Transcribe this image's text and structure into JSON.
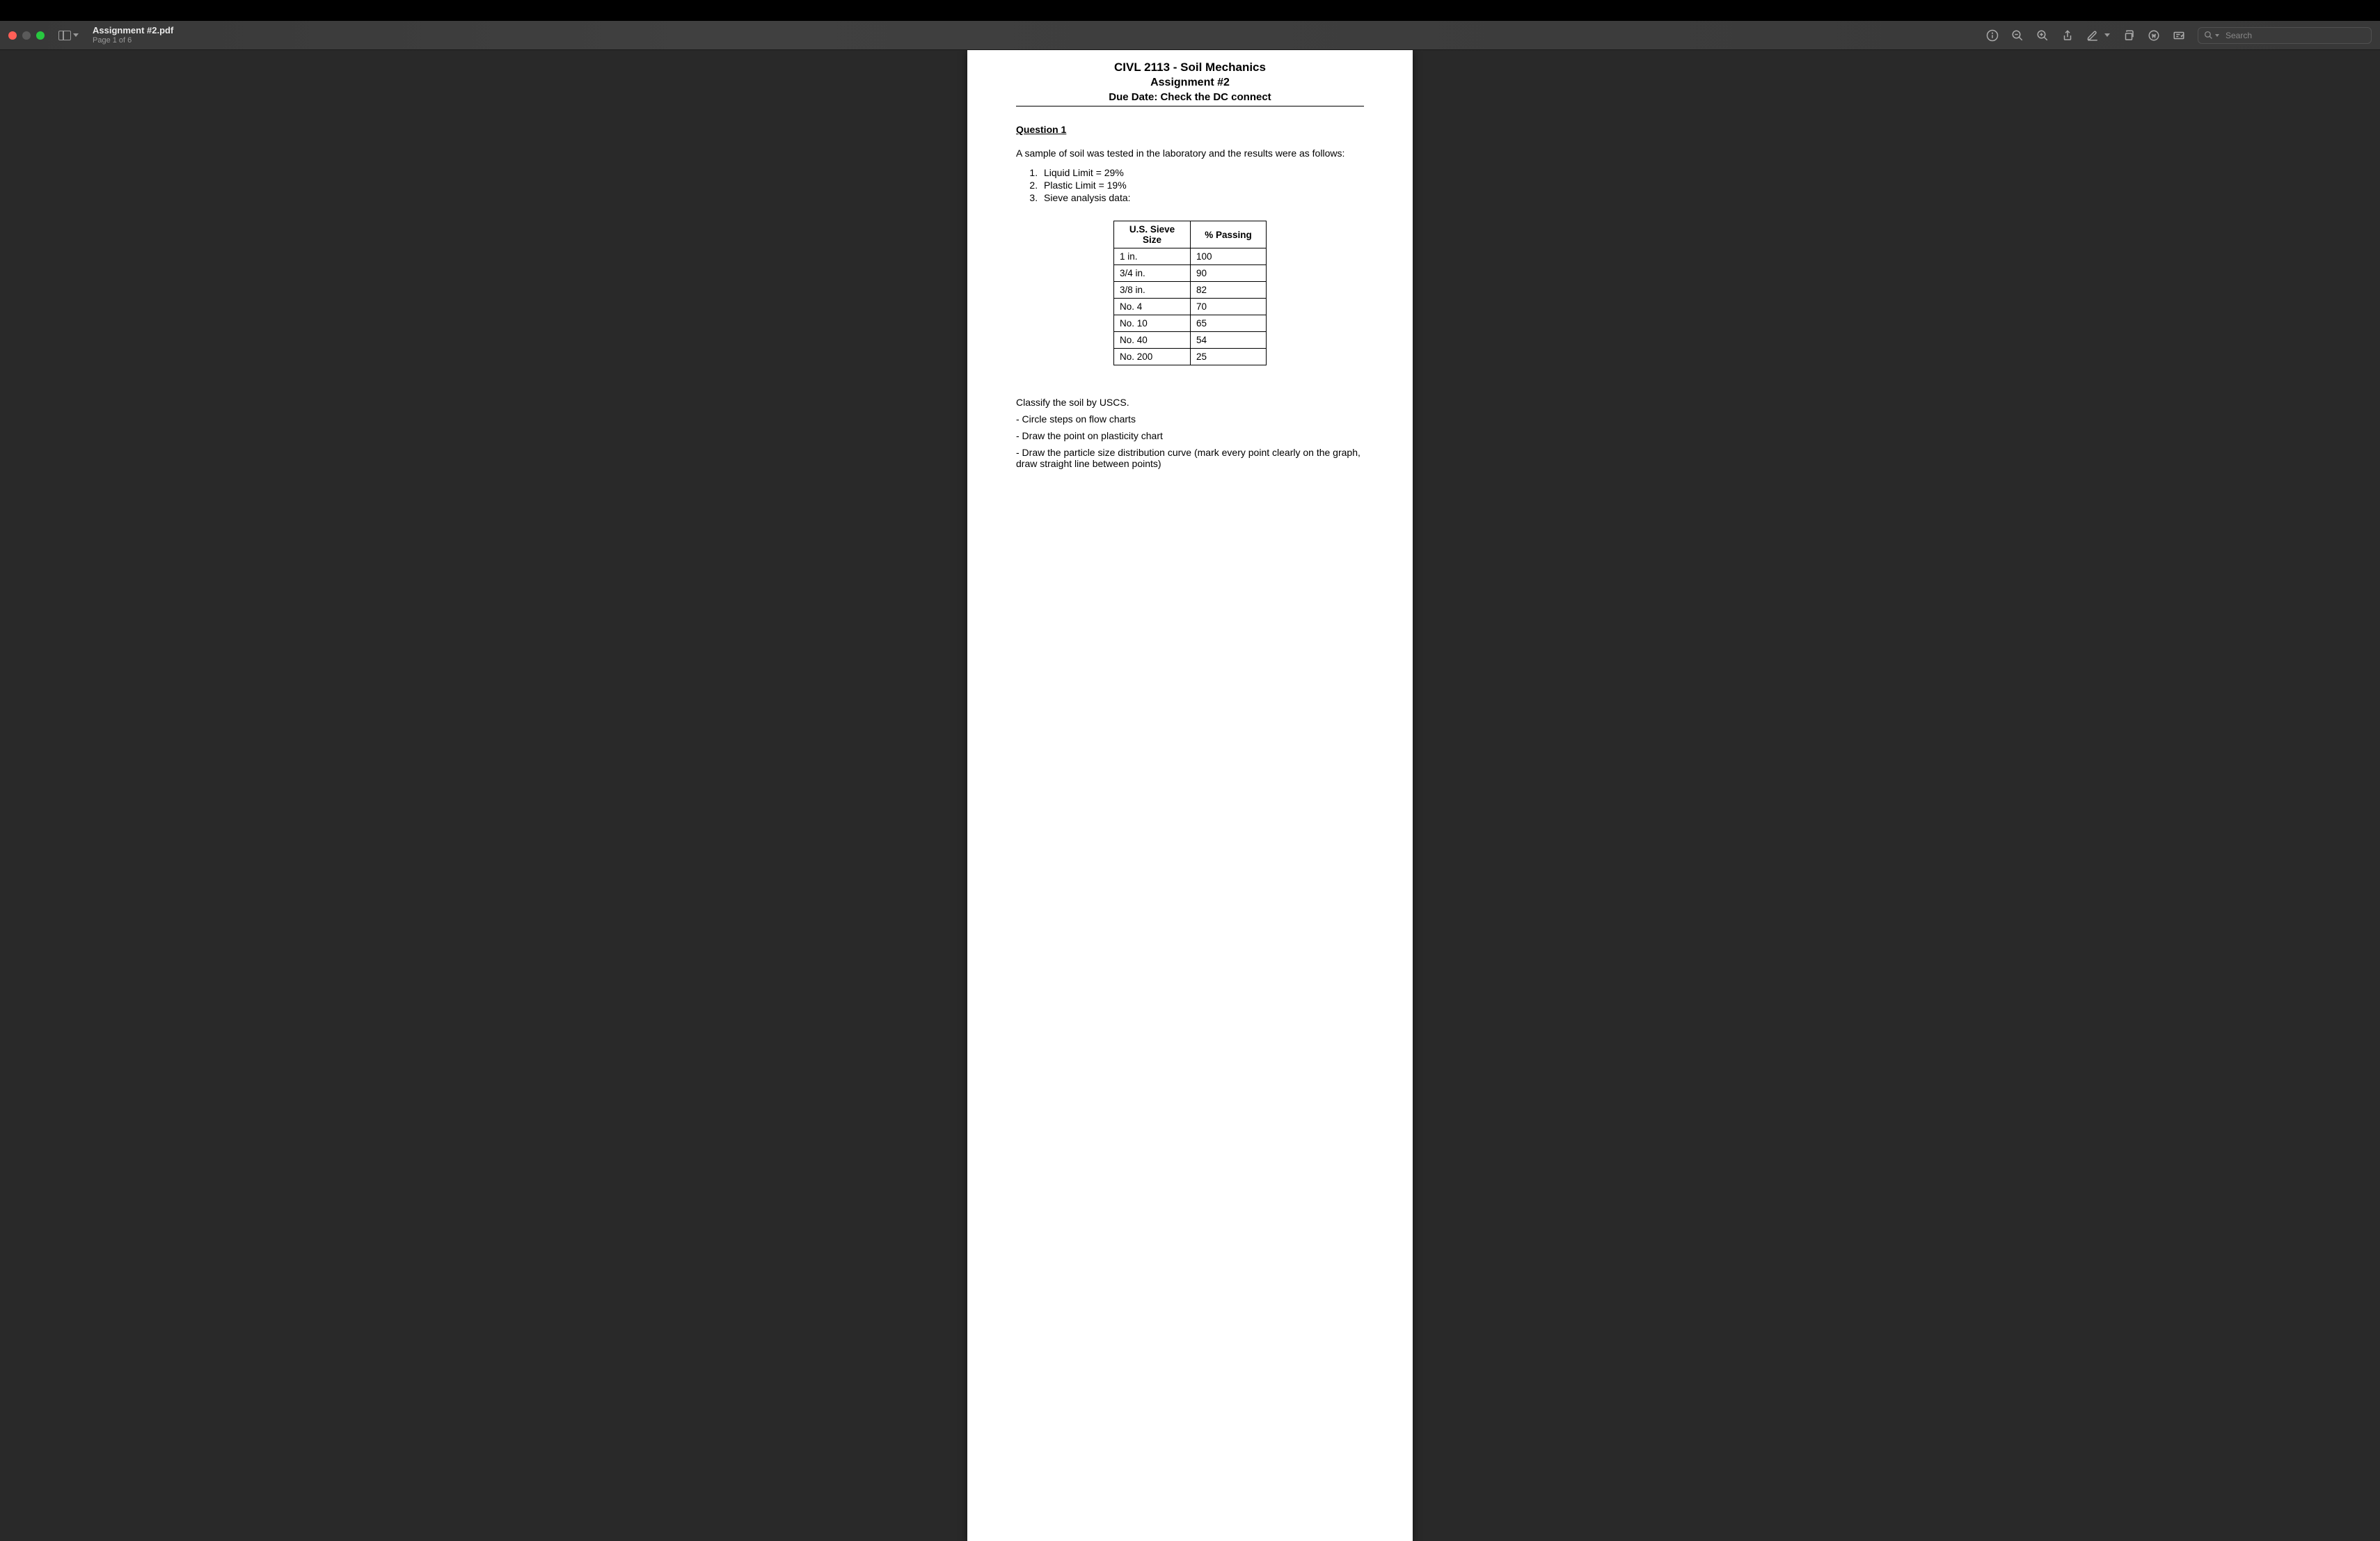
{
  "window": {
    "title": "Assignment #2.pdf",
    "page_info": "Page 1 of 6"
  },
  "search": {
    "placeholder": "Search"
  },
  "document": {
    "course": "CIVL 2113 - Soil Mechanics",
    "assignment": "Assignment #2",
    "due": "Due Date: Check the DC connect",
    "question_label": "Question 1",
    "intro": "A sample of soil was tested in the laboratory and the results were as follows:",
    "list": {
      "item1": "Liquid Limit = 29%",
      "item2": "Plastic Limit = 19%",
      "item3": "Sieve analysis data:"
    },
    "table": {
      "header1": "U.S. Sieve Size",
      "header2": "% Passing",
      "rows": [
        {
          "size": "1 in.",
          "passing": "100"
        },
        {
          "size": "3/4 in.",
          "passing": "90"
        },
        {
          "size": "3/8 in.",
          "passing": "82"
        },
        {
          "size": "No. 4",
          "passing": "70"
        },
        {
          "size": "No. 10",
          "passing": "65"
        },
        {
          "size": "No. 40",
          "passing": "54"
        },
        {
          "size": "No. 200",
          "passing": "25"
        }
      ]
    },
    "task1": "Classify the soil by USCS.",
    "task2": "- Circle steps on flow charts",
    "task3": "- Draw the point on plasticity chart",
    "task4": "- Draw the particle size distribution curve (mark every point clearly on the graph, draw straight line between points)"
  }
}
